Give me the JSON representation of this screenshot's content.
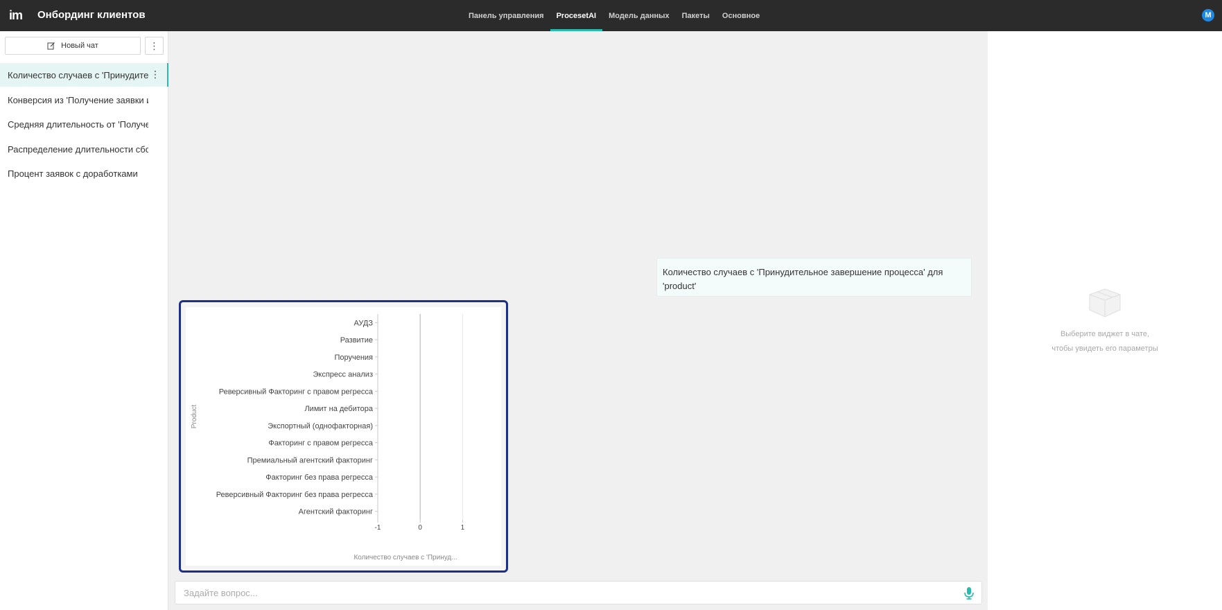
{
  "app": {
    "logo": "im",
    "title": "Онбординг клиентов",
    "avatar_letter": "M"
  },
  "nav": {
    "tabs": [
      {
        "label": "Панель управления",
        "active": false
      },
      {
        "label": "ProcesetAI",
        "active": true
      },
      {
        "label": "Модель данных",
        "active": false
      },
      {
        "label": "Пакеты",
        "active": false
      },
      {
        "label": "Основное",
        "active": false
      }
    ]
  },
  "sidebar": {
    "new_chat_label": "Новый чат",
    "more_label": "⋮",
    "items": [
      {
        "label": "Количество случаев с 'Принудительное завершение процесса' для 'product'",
        "active": true
      },
      {
        "label": "Конверсия из 'Получение заявки из ...",
        "active": false
      },
      {
        "label": "Средняя длительность от 'Получение ...",
        "active": false
      },
      {
        "label": "Распределение длительности сбора ...",
        "active": false
      },
      {
        "label": "Процент заявок с доработками",
        "active": false
      }
    ]
  },
  "chat": {
    "user_message": "Количество случаев с 'Принудительное завершение процесса' для 'product'"
  },
  "chart_data": {
    "type": "bar",
    "orientation": "horizontal",
    "categories": [
      "АУДЗ",
      "Развитие",
      "Поручения",
      "Экспресс анализ",
      "Реверсивный Факторинг с правом регресса",
      "Лимит на дебитора",
      "Экспортный (однофакторная)",
      "Факторинг с правом регресса",
      "Премиальный агентский факторинг",
      "Факторинг без права регресса",
      "Реверсивный Факторинг без права регресса",
      "Агентский факторинг"
    ],
    "values": [
      0,
      0,
      0,
      0,
      0,
      0,
      0,
      0,
      0,
      0,
      0,
      0
    ],
    "xlabel": "Количество случаев с 'Принуд...",
    "ylabel": "Product",
    "xticks": [
      "-1",
      "0",
      "1"
    ],
    "xlim": [
      -1,
      1.5
    ],
    "grid": true,
    "colors": {
      "grid": "#e6e6e6",
      "zero_line": "#bdbdbd",
      "axis": "#c8c8c8",
      "text": "#444444",
      "label": "#888888"
    }
  },
  "right_panel": {
    "empty_line1": "Выберите виджет в чате,",
    "empty_line2": "чтобы увидеть его параметры"
  },
  "input": {
    "placeholder": "Задайте вопрос...",
    "value": ""
  },
  "colors": {
    "accent": "#2bbbad",
    "topbar": "#2b2b2b",
    "widget_border": "#1e2f8a",
    "avatar": "#1e88e5"
  }
}
